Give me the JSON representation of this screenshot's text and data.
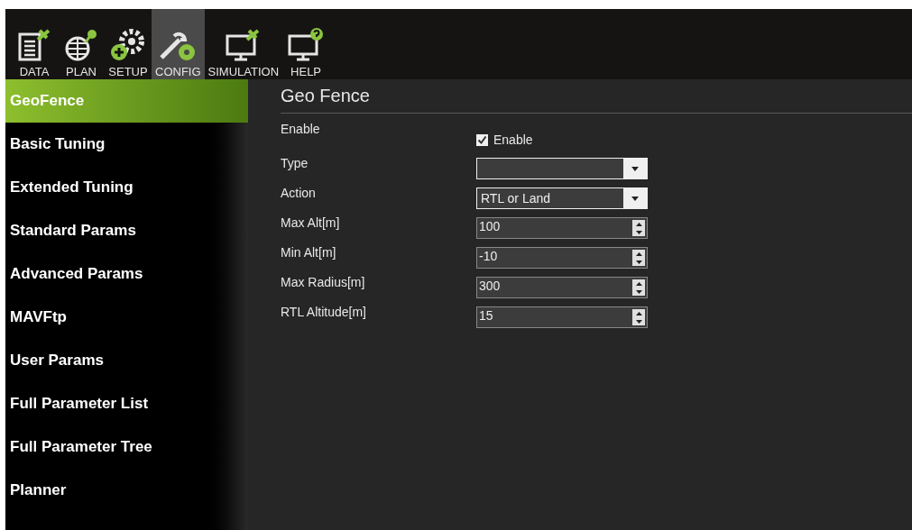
{
  "toolbar": [
    {
      "label": "DATA",
      "kind": "data",
      "selected": false
    },
    {
      "label": "PLAN",
      "kind": "plan",
      "selected": false
    },
    {
      "label": "SETUP",
      "kind": "setup",
      "selected": false
    },
    {
      "label": "CONFIG",
      "kind": "config",
      "selected": true
    },
    {
      "label": "SIMULATION",
      "kind": "sim",
      "selected": false
    },
    {
      "label": "HELP",
      "kind": "help",
      "selected": false
    }
  ],
  "sidebar": {
    "items": [
      {
        "label": "GeoFence",
        "selected": true
      },
      {
        "label": "Basic Tuning",
        "selected": false
      },
      {
        "label": "Extended Tuning",
        "selected": false
      },
      {
        "label": "Standard Params",
        "selected": false
      },
      {
        "label": "Advanced Params",
        "selected": false
      },
      {
        "label": "MAVFtp",
        "selected": false
      },
      {
        "label": "User Params",
        "selected": false
      },
      {
        "label": "Full Parameter List",
        "selected": false
      },
      {
        "label": "Full Parameter Tree",
        "selected": false
      },
      {
        "label": "Planner",
        "selected": false
      }
    ]
  },
  "panel": {
    "title": "Geo Fence",
    "fields": [
      {
        "kind": "checkbox",
        "label": "Enable",
        "text": "Enable",
        "checked": true
      },
      {
        "kind": "dropdown",
        "label": "Type"
      },
      {
        "kind": "dropdown",
        "label": "Action",
        "value": "RTL or Land"
      },
      {
        "kind": "spinner",
        "label": "Max Alt[m]",
        "value": "100"
      },
      {
        "kind": "spinner",
        "label": "Min Alt[m]",
        "value": "-10"
      },
      {
        "kind": "spinner",
        "label": "Max Radius[m]",
        "value": "300"
      },
      {
        "kind": "spinner",
        "label": "RTL Altitude[m]",
        "value": "15"
      }
    ]
  }
}
